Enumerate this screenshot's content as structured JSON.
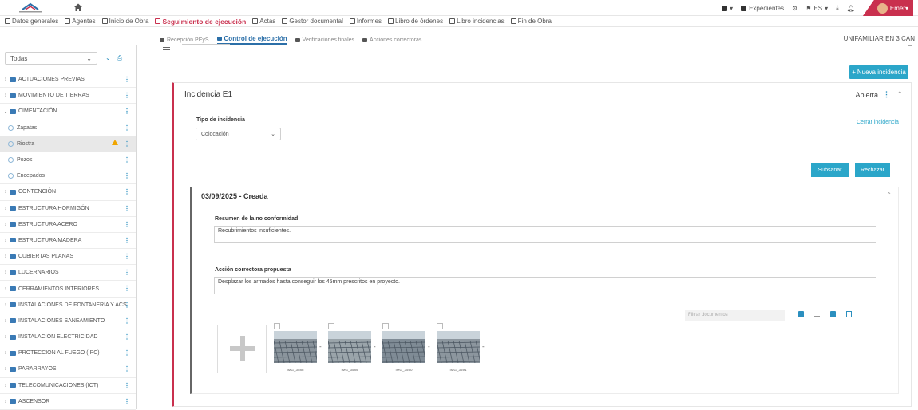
{
  "topbar": {
    "logo_text": "CONSTRUCCIONES BUENO",
    "right": {
      "expedientes": "Expedientes",
      "lang": "ES",
      "user": "Emer"
    }
  },
  "mainnav": [
    {
      "label": "Datos generales",
      "active": false
    },
    {
      "label": "Agentes",
      "active": false
    },
    {
      "label": "Inicio de Obra",
      "active": false
    },
    {
      "label": "Seguimiento de ejecución",
      "active": true
    },
    {
      "label": "Actas",
      "active": false
    },
    {
      "label": "Gestor documental",
      "active": false
    },
    {
      "label": "Informes",
      "active": false
    },
    {
      "label": "Libro de órdenes",
      "active": false
    },
    {
      "label": "Libro incidencias",
      "active": false
    },
    {
      "label": "Fin de Obra",
      "active": false
    }
  ],
  "subnav": [
    {
      "label": "Recepción PEyS",
      "active": false
    },
    {
      "label": "Control de ejecución",
      "active": true
    },
    {
      "label": "Verificaciones finales",
      "active": false
    },
    {
      "label": "Acciones correctoras",
      "active": false
    }
  ],
  "project_name": "UNIFAMILIAR EN 3 CAN",
  "sidebar": {
    "filter_value": "Todas",
    "items": [
      {
        "label": "ACTUACIONES PREVIAS",
        "type": "folder",
        "expanded": false
      },
      {
        "label": "MOVIMIENTO DE TIERRAS",
        "type": "folder",
        "expanded": false
      },
      {
        "label": "CIMENTACIÓN",
        "type": "folder",
        "expanded": true
      },
      {
        "label": "Zapatas",
        "type": "leaf"
      },
      {
        "label": "Riostra",
        "type": "leaf",
        "selected": true,
        "warning": true
      },
      {
        "label": "Pozos",
        "type": "leaf"
      },
      {
        "label": "Encepados",
        "type": "leaf"
      },
      {
        "label": "CONTENCIÓN",
        "type": "folder",
        "expanded": false
      },
      {
        "label": "ESTRUCTURA HORMIGÓN",
        "type": "folder",
        "expanded": false
      },
      {
        "label": "ESTRUCTURA ACERO",
        "type": "folder",
        "expanded": false
      },
      {
        "label": "ESTRUCTURA MADERA",
        "type": "folder",
        "expanded": false
      },
      {
        "label": "CUBIERTAS PLANAS",
        "type": "folder",
        "expanded": false
      },
      {
        "label": "LUCERNARIOS",
        "type": "folder",
        "expanded": false
      },
      {
        "label": "CERRAMIENTOS INTERIORES",
        "type": "folder",
        "expanded": false
      },
      {
        "label": "INSTALACIONES DE FONTANERÍA Y ACS",
        "type": "folder",
        "expanded": false
      },
      {
        "label": "INSTALACIONES SANEAMIENTO",
        "type": "folder",
        "expanded": false
      },
      {
        "label": "INSTALACIÓN ELECTRICIDAD",
        "type": "folder",
        "expanded": false
      },
      {
        "label": "PROTECCIÓN AL FUEGO (IPC)",
        "type": "folder",
        "expanded": false
      },
      {
        "label": "PARARRAYOS",
        "type": "folder",
        "expanded": false
      },
      {
        "label": "TELECOMUNICACIONES (ICT)",
        "type": "folder",
        "expanded": false
      },
      {
        "label": "ASCENSOR",
        "type": "folder",
        "expanded": false
      }
    ]
  },
  "content": {
    "new_button": "Nueva incidencia",
    "incidence": {
      "title": "Incidencia E1",
      "status": "Abierta",
      "tipo_label": "Tipo de incidencia",
      "tipo_value": "Colocación",
      "close_link": "Cerrar incidencia",
      "btn_subsanar": "Subsanar",
      "btn_rechazar": "Rechazar",
      "record": {
        "title": "03/09/2025 - Creada",
        "resumen_label": "Resumen de la no conformidad",
        "resumen_value": "Recubrimientos insuficientes.",
        "accion_label": "Acción correctora propuesta",
        "accion_value": "Desplazar los armados hasta conseguir los 45mm prescritos en proyecto.",
        "filter_placeholder": "Filtrar documentos",
        "images": [
          "IMG_3588",
          "IMG_3589",
          "IMG_3590",
          "IMG_3591"
        ]
      }
    }
  },
  "colors": {
    "accent": "#c9304e",
    "primary": "#2ba6c9",
    "link": "#2b6fa8"
  }
}
